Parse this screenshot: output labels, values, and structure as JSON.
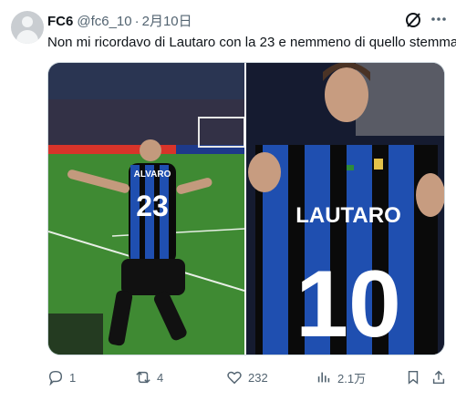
{
  "tweet": {
    "author_name": "FC6",
    "author_handle": "@fc6_10",
    "separator": "·",
    "date": "2月10日",
    "text": "Non mi ricordavo di Lautaro con la 23 e nemmeno di quello stemma"
  },
  "media": {
    "left_photo": {
      "jersey_number": "23",
      "jersey_name": "ALVARO"
    },
    "right_photo": {
      "jersey_name": "LAUTARO",
      "jersey_number": "10"
    }
  },
  "actions": {
    "reply_count": "1",
    "retweet_count": "4",
    "like_count": "232",
    "views_count": "2.1万"
  },
  "colors": {
    "text_primary": "#0f1419",
    "text_secondary": "#536471",
    "border": "#cfd9de",
    "inter_blue": "#1f4fb0",
    "inter_black": "#0a0a0a"
  },
  "icons": [
    "avatar-default",
    "grok-icon",
    "more-icon",
    "reply-icon",
    "retweet-icon",
    "like-icon",
    "views-icon",
    "bookmark-icon",
    "share-icon"
  ]
}
